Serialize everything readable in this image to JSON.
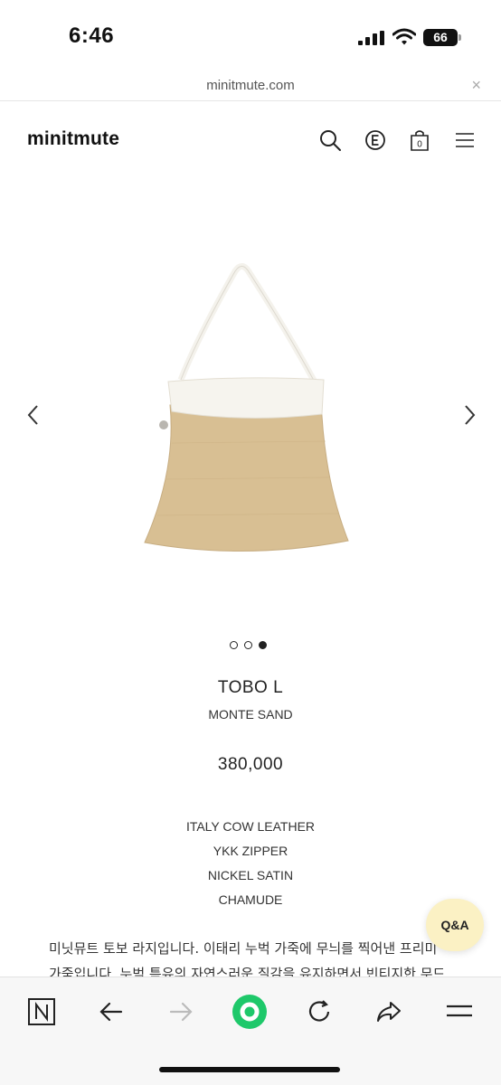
{
  "status_bar": {
    "time": "6:46",
    "battery": "66",
    "icons": [
      "cellular-signal-icon",
      "wifi-icon",
      "battery-icon"
    ]
  },
  "browser": {
    "url": "minitmute.com",
    "close_symbol": "×"
  },
  "header": {
    "logo": "minitmute",
    "cart_count": "0",
    "icons": [
      "search-icon",
      "e-circle-icon",
      "shopping-bag-icon",
      "hamburger-menu-icon"
    ]
  },
  "carousel": {
    "total_slides": 3,
    "active_slide": 3,
    "prev_icon": "chevron-left-icon",
    "next_icon": "chevron-right-icon"
  },
  "product": {
    "name": "TOBO L",
    "color": "MONTE SAND",
    "price": "380,000",
    "specs": [
      "ITALY COW LEATHER",
      "YKK ZIPPER",
      "NICKEL SATIN",
      "CHAMUDE"
    ],
    "description_lines": [
      "미닛뮤트 토보 라지입니다. 이태리 누벅 가죽에 무늬를 찍어낸 프리미",
      "가죽입니다. 누벅 특유의 자연스러운 질감을 유지하면서 빈티지한 무드"
    ]
  },
  "qa_button": {
    "label": "Q&A"
  },
  "toolbar": {
    "icons": [
      "naver-n-icon",
      "back-arrow-icon",
      "forward-arrow-icon",
      "home-green-circle-icon",
      "reload-icon",
      "share-icon",
      "menu-icon"
    ]
  },
  "colors": {
    "bag_body": "#d8bf93",
    "bag_trim": "#f6f4ee",
    "qa_bg": "#fbf1c4",
    "toolbar_green": "#1ec86a"
  }
}
